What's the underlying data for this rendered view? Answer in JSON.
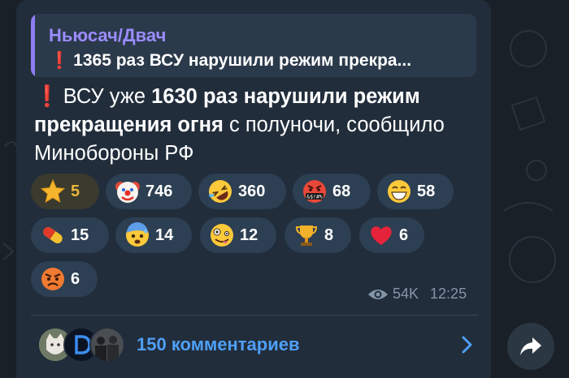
{
  "message": {
    "reply": {
      "author": "Ньюсач/Двач",
      "text": "1365 раз ВСУ нарушили режим прекра..."
    },
    "text_part1": "ВСУ уже ",
    "text_bold": "1630 раз нарушили режим прекращения огня",
    "text_part2": " с полуночи, сообщило Минобороны РФ",
    "reactions": [
      {
        "emoji": "star-icon",
        "count": "5"
      },
      {
        "emoji": "clown-face-icon",
        "count": "746"
      },
      {
        "emoji": "rolling-laughing-icon",
        "count": "360"
      },
      {
        "emoji": "cursing-face-icon",
        "count": "68"
      },
      {
        "emoji": "grinning-face-icon",
        "count": "58"
      },
      {
        "emoji": "pill-icon",
        "count": "15"
      },
      {
        "emoji": "anxious-sweat-face-icon",
        "count": "14"
      },
      {
        "emoji": "zany-face-icon",
        "count": "12"
      },
      {
        "emoji": "trophy-icon",
        "count": "8"
      },
      {
        "emoji": "red-heart-icon",
        "count": "6"
      },
      {
        "emoji": "angry-face-icon",
        "count": "6"
      }
    ],
    "cursing_symbols": "&$!#%",
    "views": "54K",
    "time": "12:25",
    "comments_label": "150 комментариев"
  },
  "colors": {
    "background": "#1a2027",
    "bubble": "#212d3b",
    "reply_accent": "#8f7df2",
    "link": "#4f9ff7",
    "paid_star": "#e9b73a"
  }
}
